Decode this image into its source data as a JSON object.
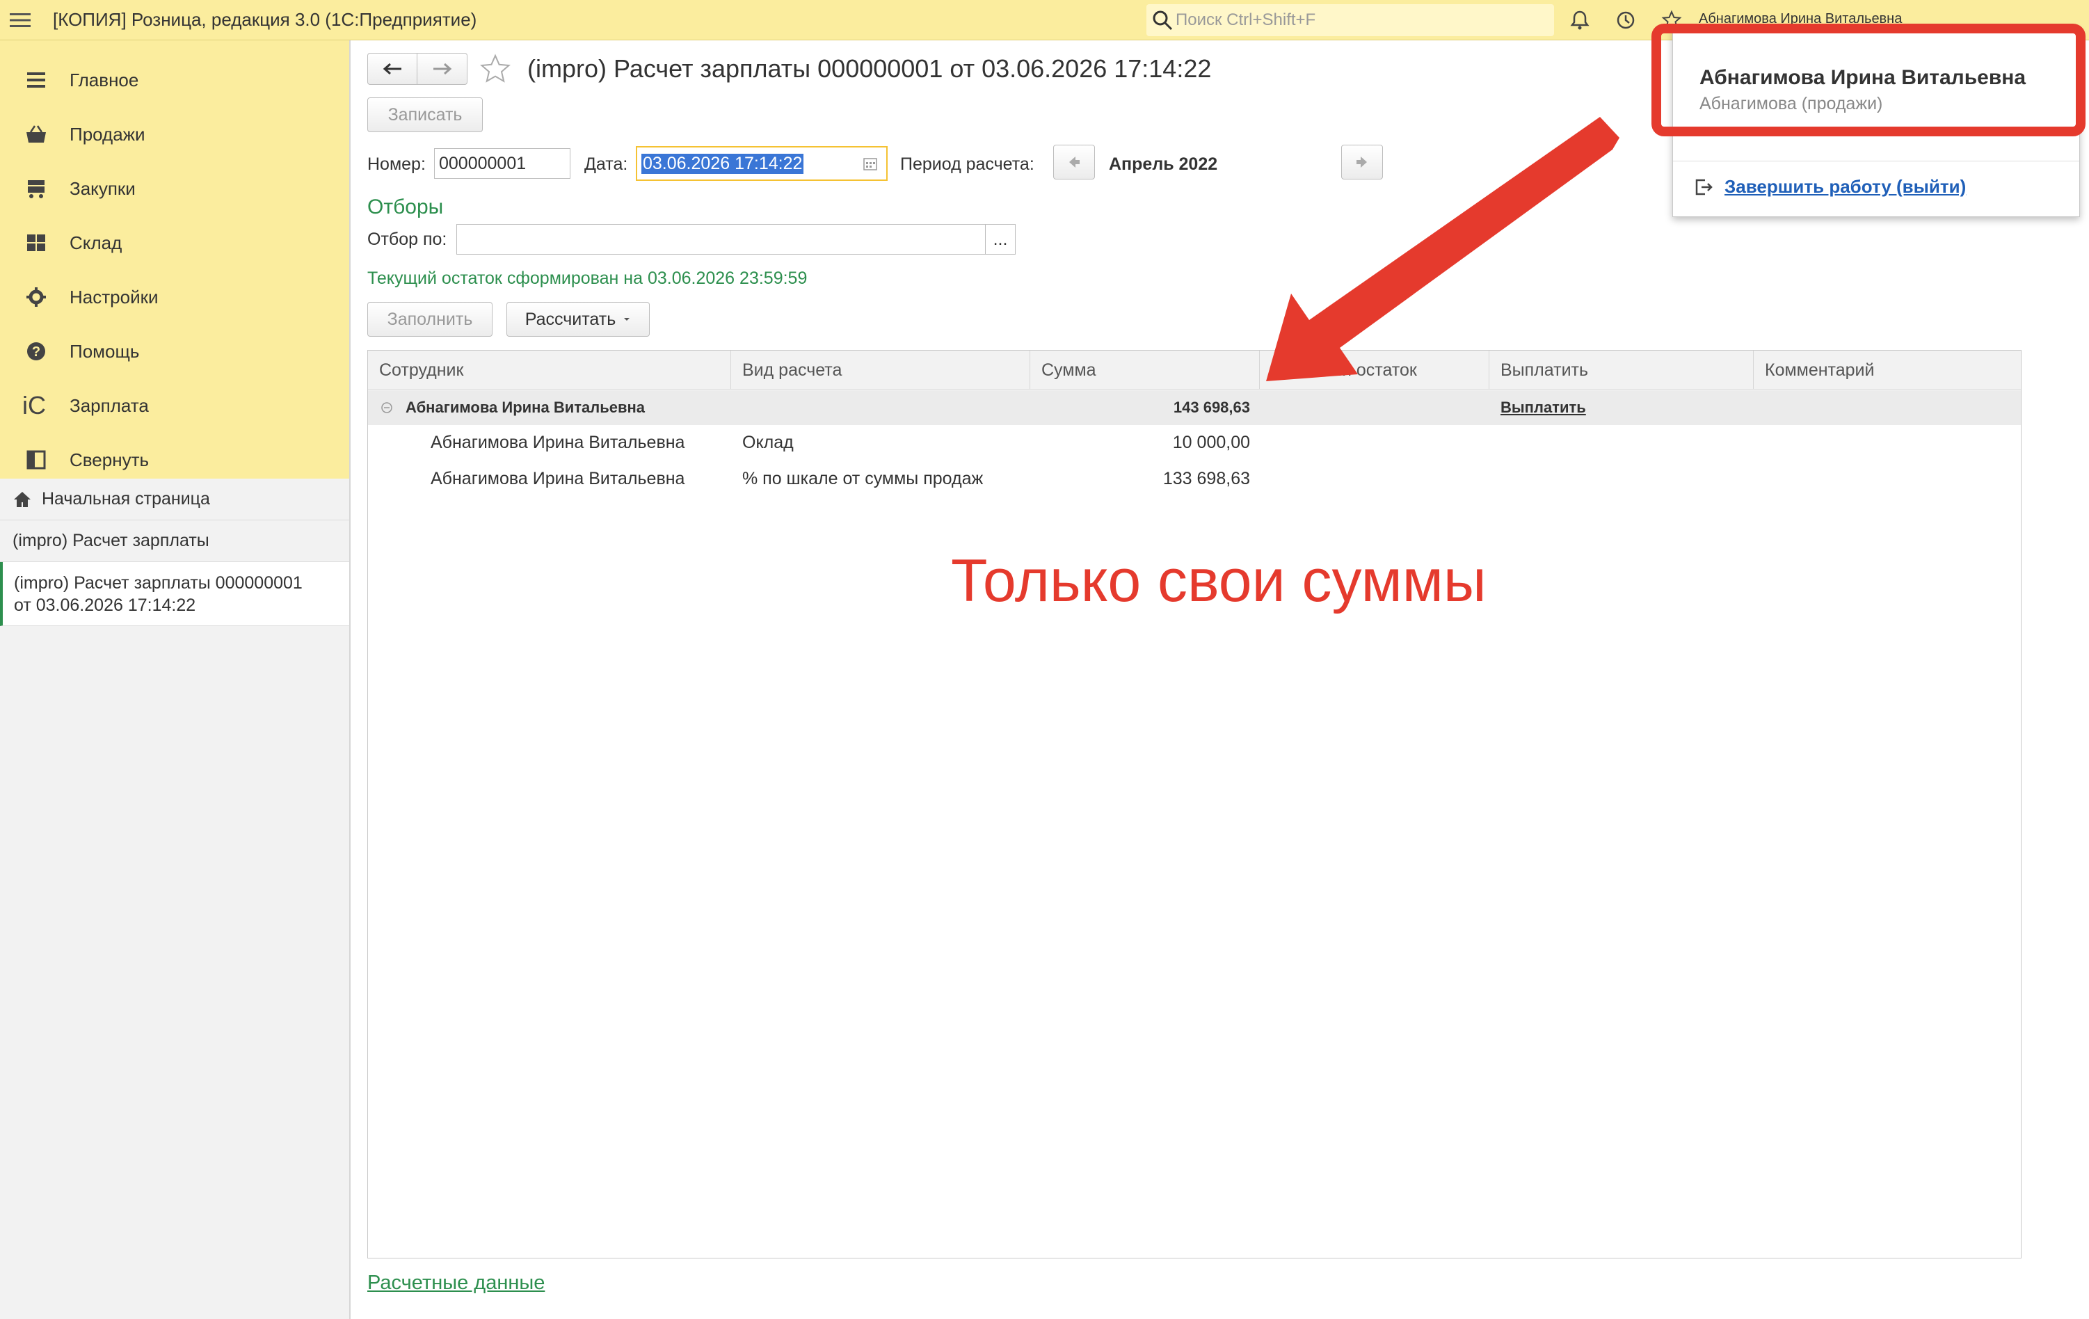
{
  "app": {
    "title": "[КОПИЯ] Розница, редакция 3.0  (1С:Предприятие)",
    "search_placeholder": "Поиск Ctrl+Shift+F",
    "current_user_short": "Абнагимова Ирина Витальевна"
  },
  "sidebar": {
    "sections": [
      {
        "label": "Главное",
        "icon": "list-icon"
      },
      {
        "label": "Продажи",
        "icon": "basket-icon"
      },
      {
        "label": "Закупки",
        "icon": "cart-icon"
      },
      {
        "label": "Склад",
        "icon": "warehouse-icon"
      },
      {
        "label": "Настройки",
        "icon": "gear-icon"
      },
      {
        "label": "Помощь",
        "icon": "help-icon"
      },
      {
        "label": "Зарплата",
        "icon": "1c-icon"
      },
      {
        "label": "Свернуть",
        "icon": "collapse-icon"
      }
    ],
    "open_windows": {
      "home": "Начальная страница",
      "list": "(impro) Расчет зарплаты",
      "active_line1": "(impro) Расчет зарплаты 000000001",
      "active_line2": "от 03.06.2026 17:14:22"
    }
  },
  "form": {
    "title": "(impro) Расчет зарплаты 000000001 от 03.06.2026 17:14:22",
    "save_button": "Записать",
    "number_label": "Номер:",
    "number_value": "000000001",
    "date_label": "Дата:",
    "date_value": "03.06.2026 17:14:22",
    "period_label": "Период расчета:",
    "period_value": "Апрель 2022",
    "filters_header": "Отборы",
    "filter_label": "Отбор по:",
    "filter_value": "",
    "filter_select_button": "...",
    "balance_info": "Текущий остаток сформирован на 03.06.2026 23:59:59",
    "fill_button": "Заполнить",
    "calculate_button": "Рассчитать",
    "footer_link": "Расчетные данные"
  },
  "table": {
    "columns": [
      "Сотрудник",
      "Вид расчета",
      "Сумма",
      "ий остаток",
      "Выплатить",
      "Комментарий"
    ],
    "group": {
      "employee": "Абнагимова Ирина Витальевна",
      "sum": "143 698,63",
      "pay_link": "Выплатить"
    },
    "rows": [
      {
        "employee": "Абнагимова Ирина Витальевна",
        "type": "Оклад",
        "sum": "10 000,00"
      },
      {
        "employee": "Абнагимова Ирина Витальевна",
        "type": "% по шкале от суммы продаж",
        "sum": "133 698,63"
      }
    ]
  },
  "annotation": {
    "text": "Только свои суммы",
    "color": "#e53a2d"
  },
  "user_popup": {
    "name": "Абнагимова Ирина Витальевна",
    "login": "Абнагимова (продажи)",
    "logout": "Завершить работу (выйти)"
  },
  "colors": {
    "accent_yellow": "#fbed9e",
    "green_text": "#2d8f4e",
    "highlight_red": "#e53a2d",
    "link_blue": "#1f5fb8"
  }
}
